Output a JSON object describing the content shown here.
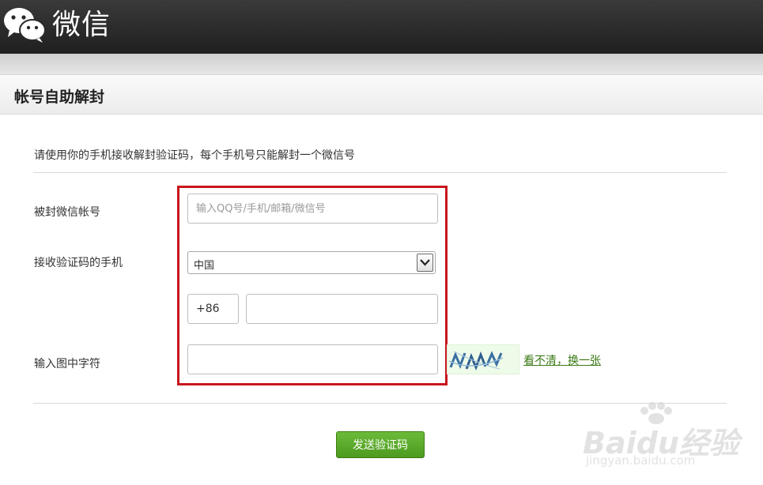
{
  "header": {
    "brand": "微信",
    "logo_icon": "wechat-logo-icon"
  },
  "page": {
    "title": "帐号自助解封"
  },
  "instruction": "请使用你的手机接收解封验证码，每个手机号只能解封一个微信号",
  "form": {
    "account_label": "被封微信帐号",
    "account_placeholder": "输入QQ号/手机/邮箱/微信号",
    "phone_label": "接收验证码的手机",
    "country_selected": "中国",
    "phone_prefix": "+86",
    "phone_value": "",
    "captcha_label": "输入图中字符",
    "captcha_value": "",
    "refresh_link": "看不清，换一张",
    "submit_label": "发送验证码"
  },
  "watermark": {
    "main": "Baidu经验",
    "sub": "jingyan.baidu.com"
  },
  "colors": {
    "accent_green": "#5aa82a",
    "highlight_red": "#c8161e",
    "header_dark": "#262626"
  }
}
